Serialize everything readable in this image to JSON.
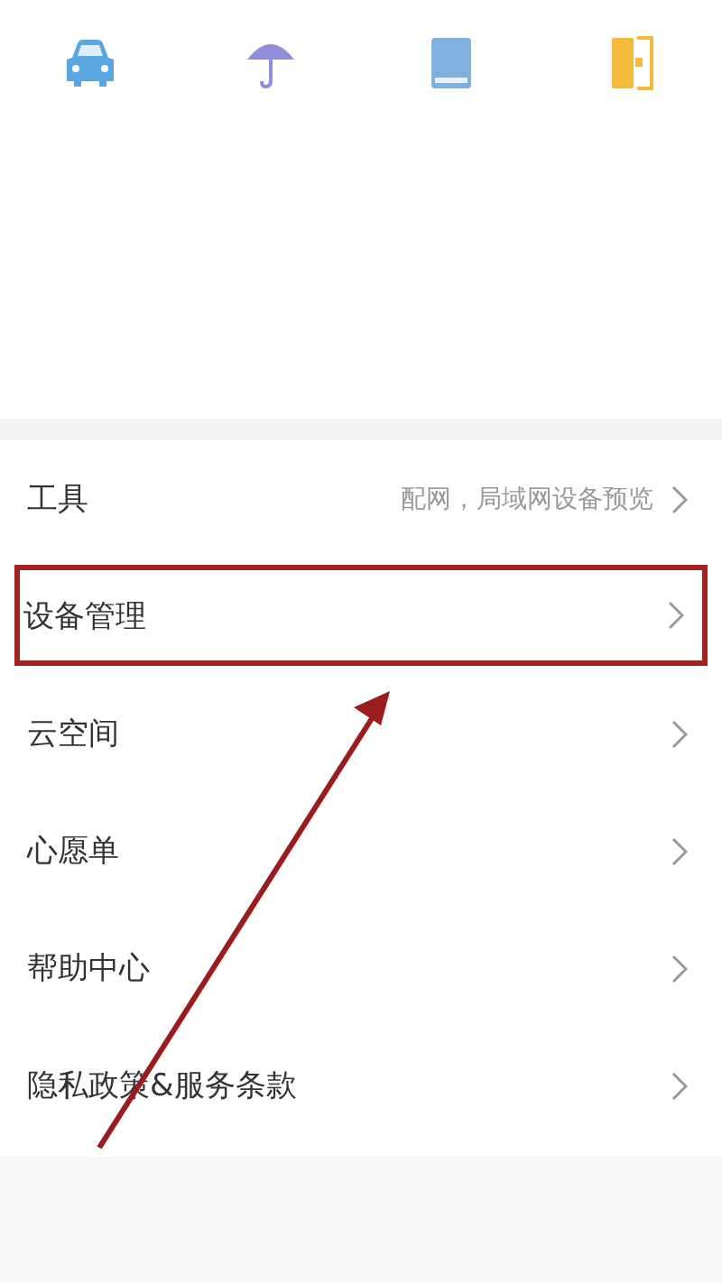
{
  "shortcuts": [
    {
      "kind": "car"
    },
    {
      "kind": "umbrella"
    },
    {
      "kind": "book"
    },
    {
      "kind": "door"
    }
  ],
  "menu": [
    {
      "label": "工具",
      "detail": "配网，局域网设备预览",
      "highlighted": false
    },
    {
      "label": "设备管理",
      "highlighted": true
    },
    {
      "label": "云空间",
      "highlighted": false
    },
    {
      "label": "心愿单",
      "highlighted": false
    },
    {
      "label": "帮助中心",
      "highlighted": false
    },
    {
      "label": "隐私政策&服务条款",
      "highlighted": false
    }
  ]
}
